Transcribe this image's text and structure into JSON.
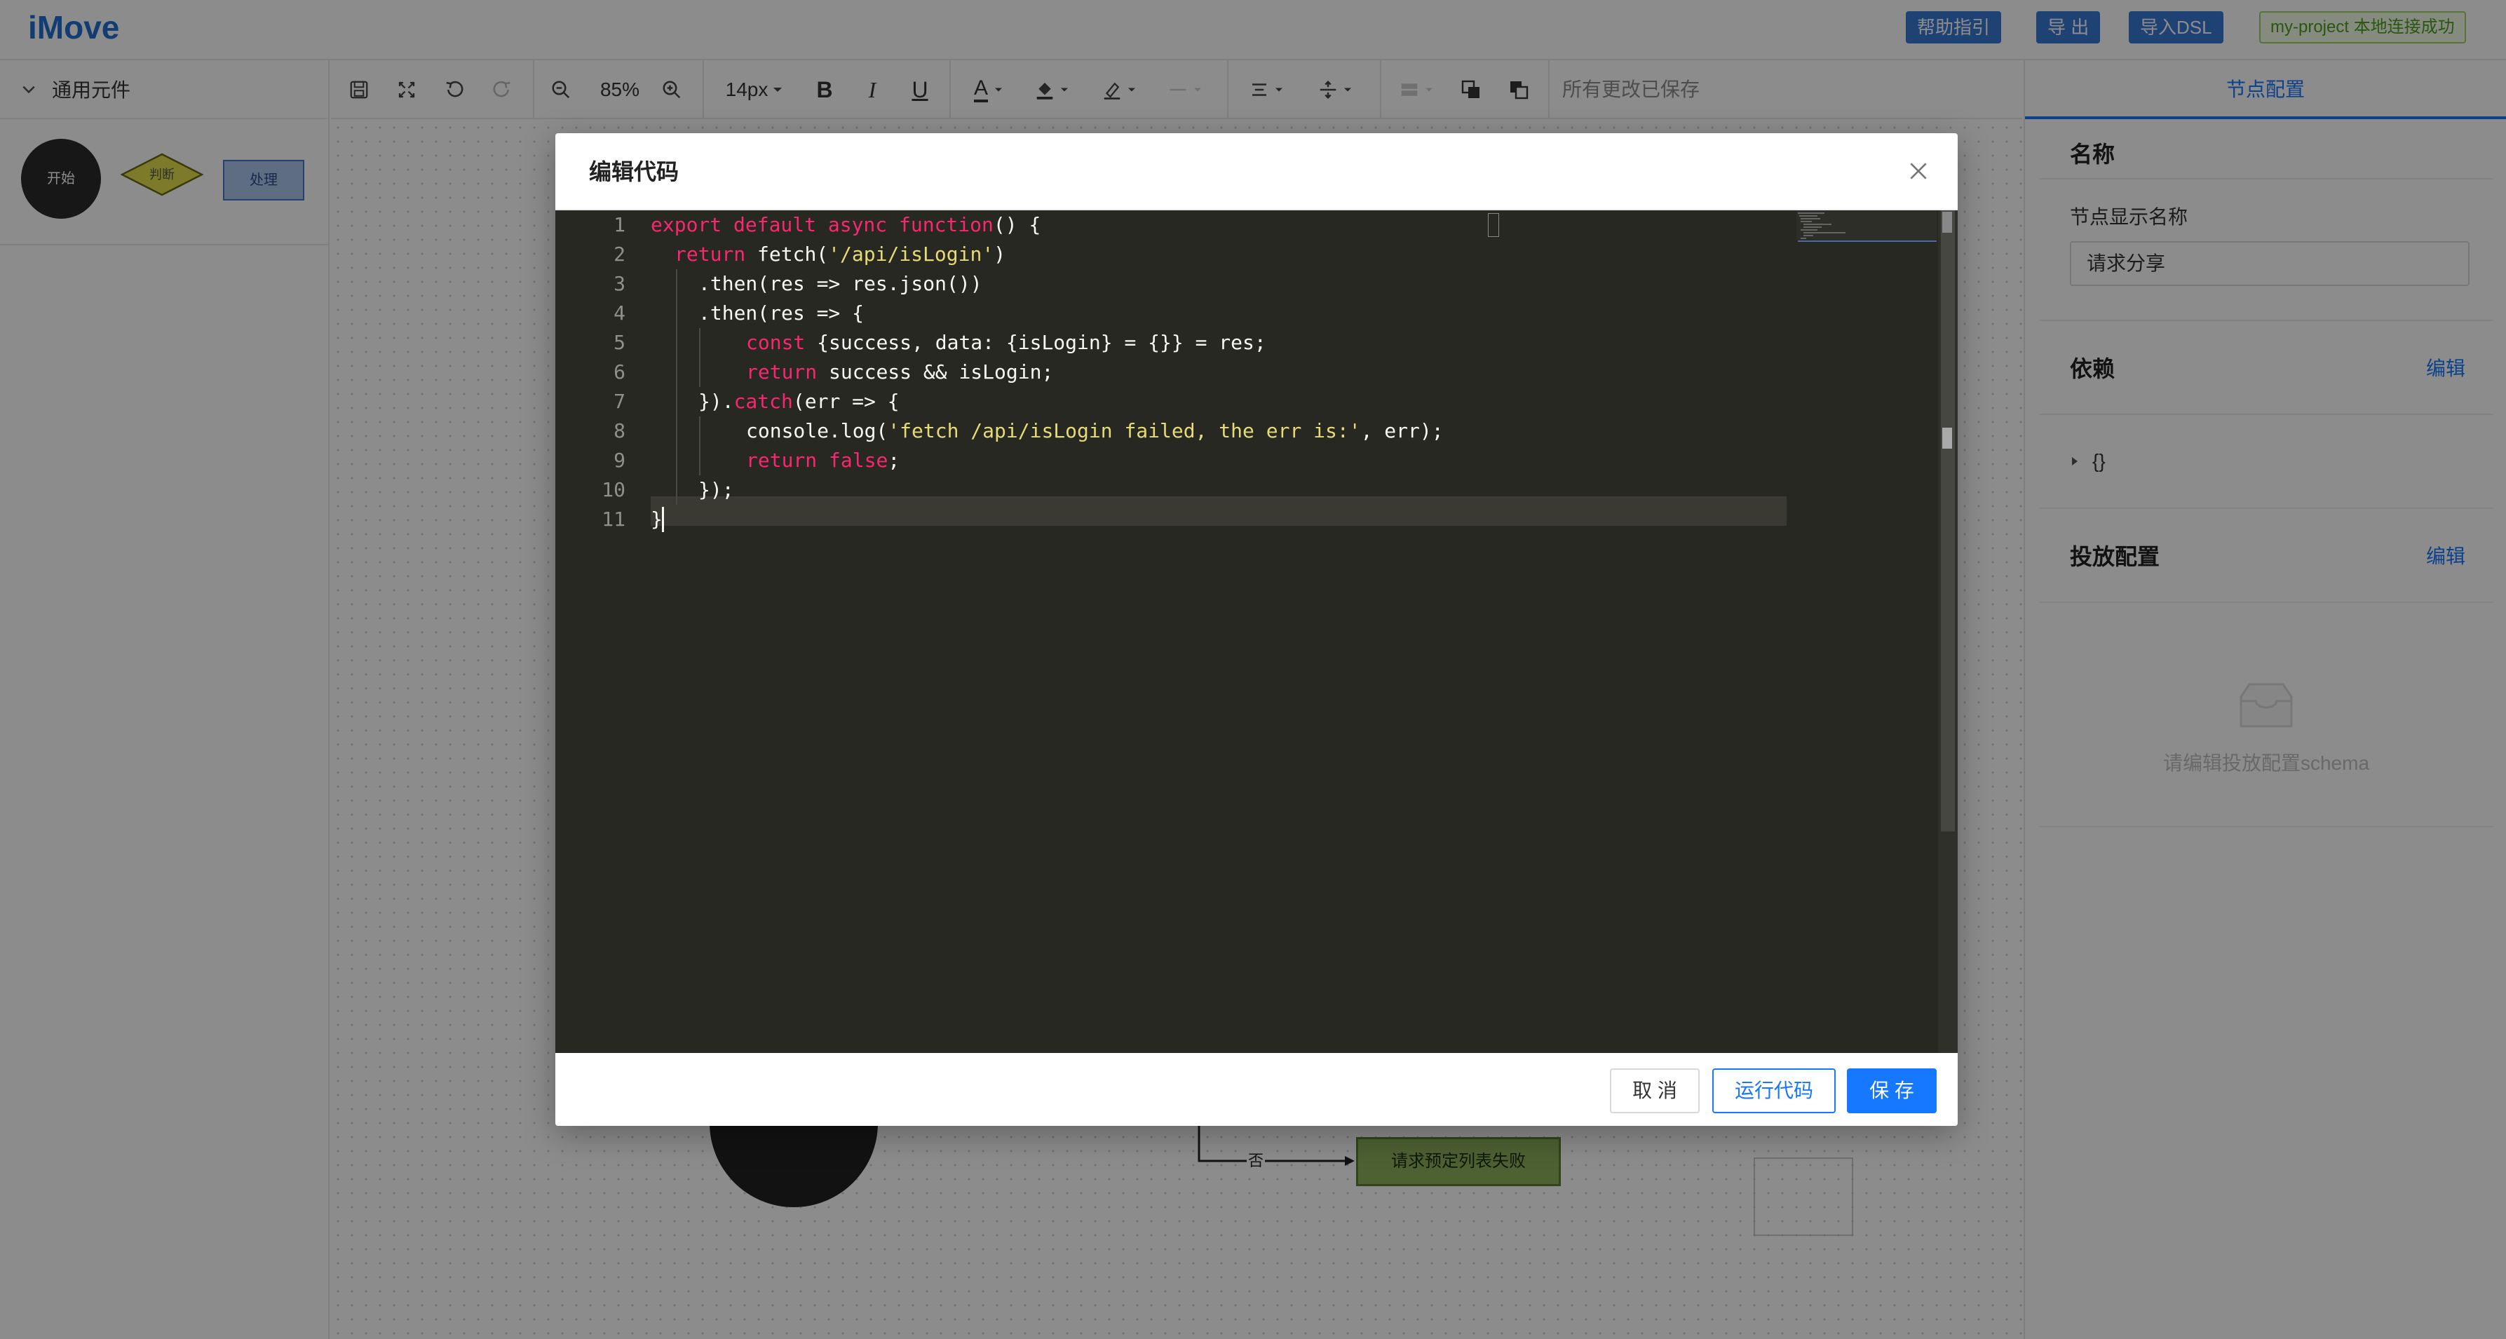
{
  "app": {
    "logo": "iMove"
  },
  "header": {
    "help_label": "帮助指引",
    "export_label": "导 出",
    "import_label": "导入DSL",
    "project_status": "my-project 本地连接成功"
  },
  "left_panel": {
    "section_title": "通用元件",
    "shapes": {
      "start": "开始",
      "judge": "判断",
      "process": "处理"
    }
  },
  "toolbar": {
    "zoom": "85%",
    "font_size": "14px",
    "bold": "B",
    "italic": "I",
    "underline": "U",
    "font_color_letter": "A",
    "status": "所有更改已保存"
  },
  "canvas": {
    "edge_label": "否",
    "fail_node": "请求预定列表失败"
  },
  "right_panel": {
    "tab": "节点配置",
    "name_section": "名称",
    "display_name_label": "节点显示名称",
    "display_name_value": "请求分享",
    "deps_section": "依赖",
    "deps_edit": "编辑",
    "deps_tree": "{}",
    "delivery_section": "投放配置",
    "delivery_edit": "编辑",
    "delivery_empty": "请编辑投放配置schema"
  },
  "modal": {
    "title": "编辑代码",
    "line_numbers": [
      "1",
      "2",
      "3",
      "4",
      "5",
      "6",
      "7",
      "8",
      "9",
      "10",
      "11"
    ],
    "code": {
      "l1": {
        "kw": "export default async function",
        "rest": "() {"
      },
      "l2": {
        "kw": "return",
        "mid": " fetch(",
        "str": "'/api/isLogin'",
        "rest": ")"
      },
      "l3": {
        "text": ".then(res => res.json())"
      },
      "l4": {
        "text": ".then(res => {"
      },
      "l5": {
        "kw": "const",
        "rest": " {success, data: {isLogin} = {}} = res;"
      },
      "l6": {
        "kw": "return",
        "rest": " success && isLogin;"
      },
      "l7": {
        "pre": "}).",
        "kw": "catch",
        "rest": "(err => {"
      },
      "l8": {
        "pre": "console.log(",
        "str": "'fetch /api/isLogin failed, the err is:'",
        "rest": ", err);"
      },
      "l9": {
        "kw": "return",
        "kw2": "false",
        "rest": ";"
      },
      "l10": {
        "text": "});"
      },
      "l11": {
        "text": "}"
      }
    },
    "cancel_label": "取 消",
    "run_label": "运行代码",
    "save_label": "保 存"
  },
  "colors": {
    "editor_bg": "#272822",
    "keyword": "#f92672",
    "string": "#e6db74",
    "primary": "#1677ff"
  }
}
